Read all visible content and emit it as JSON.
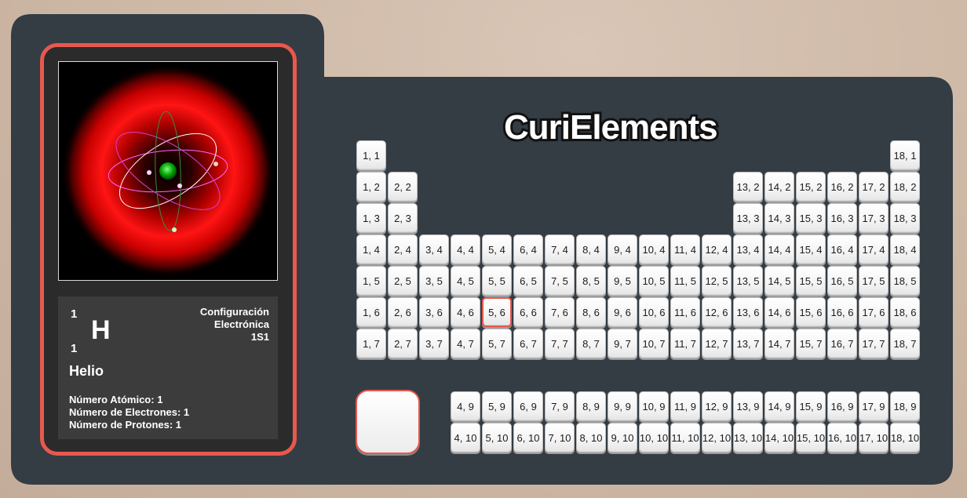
{
  "app": {
    "logo_text": "CuriElements"
  },
  "colors": {
    "board": "#343c44",
    "accent": "#e8584e",
    "card_bg": "#3c3c3c",
    "cell_bg": "#f4f4f4"
  },
  "atom_view": {
    "description_icon": "atom-model-icon",
    "nucleus_color": "#00b000",
    "cloud_color": "#ff0000"
  },
  "element": {
    "atomic_number": "1",
    "mass_number": "1",
    "symbol": "H",
    "name": "Helio",
    "config_line1": "Configuración",
    "config_line2": "Electrónica",
    "config_value": "1S1",
    "detail_atomic": "Número Atómico: 1",
    "detail_electrons": "Número de Electrones: 1",
    "detail_protons": "Número de Protones: 1"
  },
  "selected_cell": "5, 6",
  "cells": [
    "1, 1",
    "18, 1",
    "1, 2",
    "2, 2",
    "13, 2",
    "14, 2",
    "15, 2",
    "16, 2",
    "17, 2",
    "18, 2",
    "1, 3",
    "2, 3",
    "13, 3",
    "14, 3",
    "15, 3",
    "16, 3",
    "17, 3",
    "18, 3",
    "1, 4",
    "2, 4",
    "3, 4",
    "4, 4",
    "5, 4",
    "6, 4",
    "7, 4",
    "8, 4",
    "9, 4",
    "10, 4",
    "11, 4",
    "12, 4",
    "13, 4",
    "14, 4",
    "15, 4",
    "16, 4",
    "17, 4",
    "18, 4",
    "1, 5",
    "2, 5",
    "3, 5",
    "4, 5",
    "5, 5",
    "6, 5",
    "7, 5",
    "8, 5",
    "9, 5",
    "10, 5",
    "11, 5",
    "12, 5",
    "13, 5",
    "14, 5",
    "15, 5",
    "16, 5",
    "17, 5",
    "18, 5",
    "1, 6",
    "2, 6",
    "3, 6",
    "4, 6",
    "5, 6",
    "6, 6",
    "7, 6",
    "8, 6",
    "9, 6",
    "10, 6",
    "11, 6",
    "12, 6",
    "13, 6",
    "14, 6",
    "15, 6",
    "16, 6",
    "17, 6",
    "18, 6",
    "1, 7",
    "2, 7",
    "3, 7",
    "4, 7",
    "5, 7",
    "6, 7",
    "7, 7",
    "8, 7",
    "9, 7",
    "10, 7",
    "11, 7",
    "12, 7",
    "13, 7",
    "14, 7",
    "15, 7",
    "16, 7",
    "17, 7",
    "18, 7",
    "4, 9",
    "5, 9",
    "6, 9",
    "7, 9",
    "8, 9",
    "9, 9",
    "10, 9",
    "11, 9",
    "12, 9",
    "13, 9",
    "14, 9",
    "15, 9",
    "16, 9",
    "17, 9",
    "18, 9",
    "4, 10",
    "5, 10",
    "6, 10",
    "7, 10",
    "8, 10",
    "9, 10",
    "10, 10",
    "11, 10",
    "12, 10",
    "13, 10",
    "14, 10",
    "15, 10",
    "16, 10",
    "17, 10",
    "18, 10"
  ]
}
